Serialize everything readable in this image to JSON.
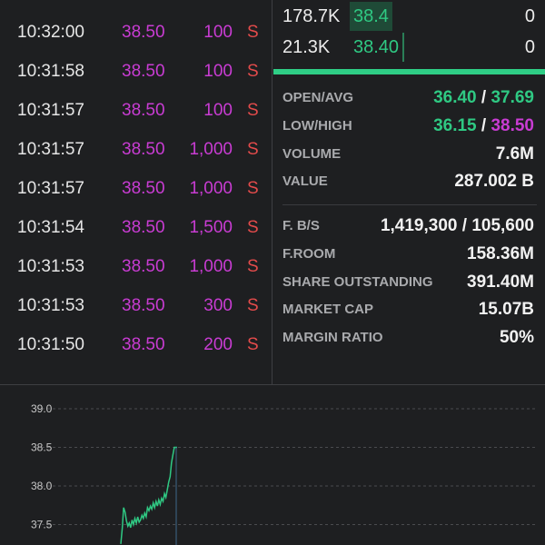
{
  "trades": [
    {
      "time": "10:32:00",
      "price": "38.50",
      "volume": "100",
      "side": "S"
    },
    {
      "time": "10:31:58",
      "price": "38.50",
      "volume": "100",
      "side": "S"
    },
    {
      "time": "10:31:57",
      "price": "38.50",
      "volume": "100",
      "side": "S"
    },
    {
      "time": "10:31:57",
      "price": "38.50",
      "volume": "1,000",
      "side": "S"
    },
    {
      "time": "10:31:57",
      "price": "38.50",
      "volume": "1,000",
      "side": "S"
    },
    {
      "time": "10:31:54",
      "price": "38.50",
      "volume": "1,500",
      "side": "S"
    },
    {
      "time": "10:31:53",
      "price": "38.50",
      "volume": "1,000",
      "side": "S"
    },
    {
      "time": "10:31:53",
      "price": "38.50",
      "volume": "300",
      "side": "S"
    },
    {
      "time": "10:31:50",
      "price": "38.50",
      "volume": "200",
      "side": "S"
    }
  ],
  "bids": [
    {
      "volume": "178.7K",
      "price": "38.4",
      "offer_volume": "0"
    },
    {
      "volume": "21.3K",
      "price": "38.40",
      "offer_volume": "0"
    }
  ],
  "stats": {
    "open_avg": {
      "label": "OPEN/AVG",
      "open": "36.40",
      "sep": "/",
      "avg": "37.69"
    },
    "low_high": {
      "label": "LOW/HIGH",
      "low": "36.15",
      "sep": "/",
      "high": "38.50"
    },
    "volume": {
      "label": "VOLUME",
      "value": "7.6M"
    },
    "value": {
      "label": "VALUE",
      "value": "287.002 B"
    },
    "fbs": {
      "label": "F. B/S",
      "value": "1,419,300 / 105,600"
    },
    "froom": {
      "label": "F.ROOM",
      "value": "158.36M"
    },
    "shares": {
      "label": "SHARE OUTSTANDING",
      "value": "391.40M"
    },
    "mcap": {
      "label": "MARKET CAP",
      "value": "15.07B"
    },
    "margin": {
      "label": "MARGIN RATIO",
      "value": "50%"
    }
  },
  "colors": {
    "up": "#2fc983",
    "ceiling": "#c93cd3",
    "sell": "#e34b4b"
  },
  "chart_data": {
    "type": "line",
    "y_ticks": [
      "39.0",
      "38.5",
      "38.0",
      "37.5"
    ],
    "ylim": [
      37.25,
      39.0
    ],
    "grid": true,
    "x": [
      0,
      1,
      2,
      3,
      4,
      5,
      6,
      7,
      8,
      9,
      10,
      11,
      12,
      13,
      14,
      15,
      16,
      17,
      18,
      19,
      20,
      21,
      22,
      23,
      24,
      25,
      26,
      27,
      28,
      29,
      30,
      31,
      32,
      33,
      34,
      35,
      36,
      37,
      38,
      39,
      40
    ],
    "values": [
      37.25,
      37.45,
      37.72,
      37.66,
      37.55,
      37.48,
      37.52,
      37.46,
      37.56,
      37.5,
      37.58,
      37.52,
      37.6,
      37.53,
      37.56,
      37.62,
      37.58,
      37.65,
      37.6,
      37.72,
      37.68,
      37.74,
      37.7,
      37.78,
      37.72,
      37.8,
      37.74,
      37.82,
      37.76,
      37.84,
      37.8,
      37.9,
      37.85,
      37.95,
      38.05,
      38.12,
      38.3,
      38.4,
      38.5,
      38.5,
      38.5
    ]
  }
}
